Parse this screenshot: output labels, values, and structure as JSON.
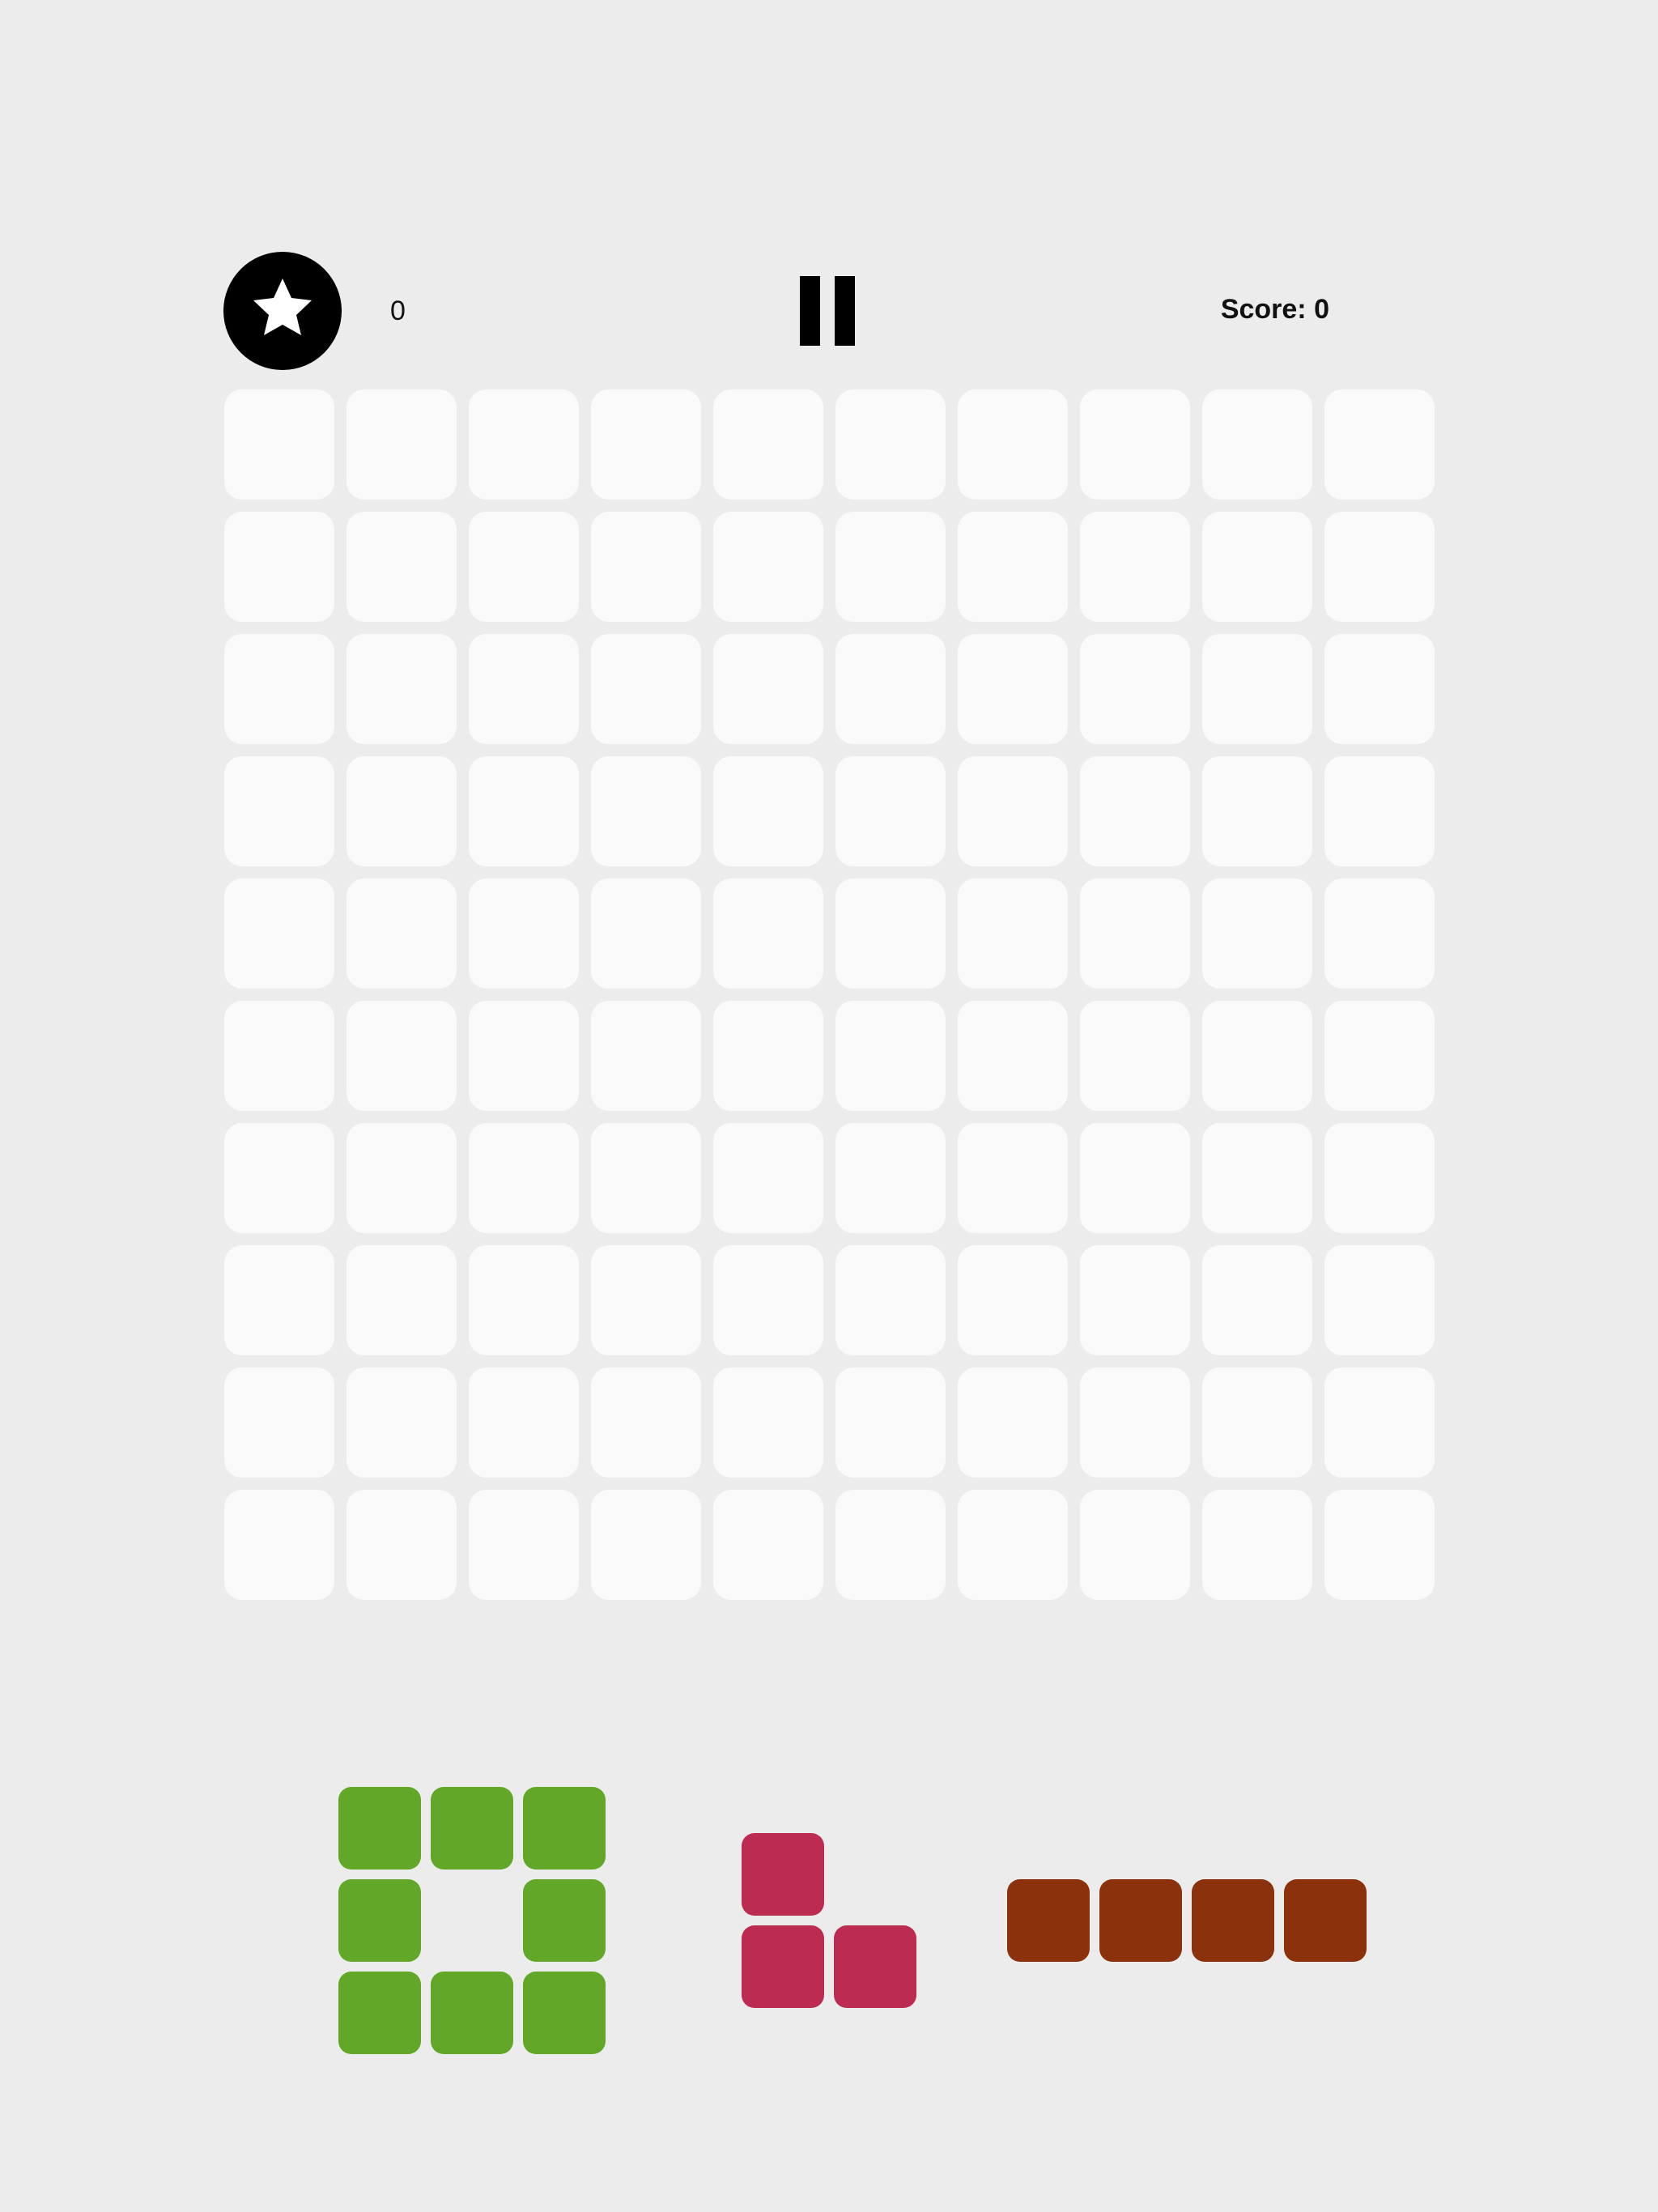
{
  "header": {
    "star_count": "0",
    "score_label": "Score: 0",
    "star_icon": "star-icon",
    "pause_icon": "pause-icon"
  },
  "board": {
    "rows": 10,
    "cols": 10,
    "empty_cell_color": "#fafafa",
    "background_color": "#ececec"
  },
  "tray": {
    "pieces": [
      {
        "name": "green-ring-piece",
        "color": "#62a728",
        "cells": [
          [
            0,
            0
          ],
          [
            0,
            1
          ],
          [
            0,
            2
          ],
          [
            1,
            0
          ],
          [
            1,
            2
          ],
          [
            2,
            0
          ],
          [
            2,
            1
          ],
          [
            2,
            2
          ]
        ]
      },
      {
        "name": "pink-corner-piece",
        "color": "#bb2b52",
        "cells": [
          [
            0,
            0
          ],
          [
            1,
            0
          ],
          [
            1,
            1
          ]
        ]
      },
      {
        "name": "brown-bar-piece",
        "color": "#8b320d",
        "cells": [
          [
            0,
            0
          ],
          [
            0,
            1
          ],
          [
            0,
            2
          ],
          [
            0,
            3
          ]
        ]
      }
    ]
  }
}
